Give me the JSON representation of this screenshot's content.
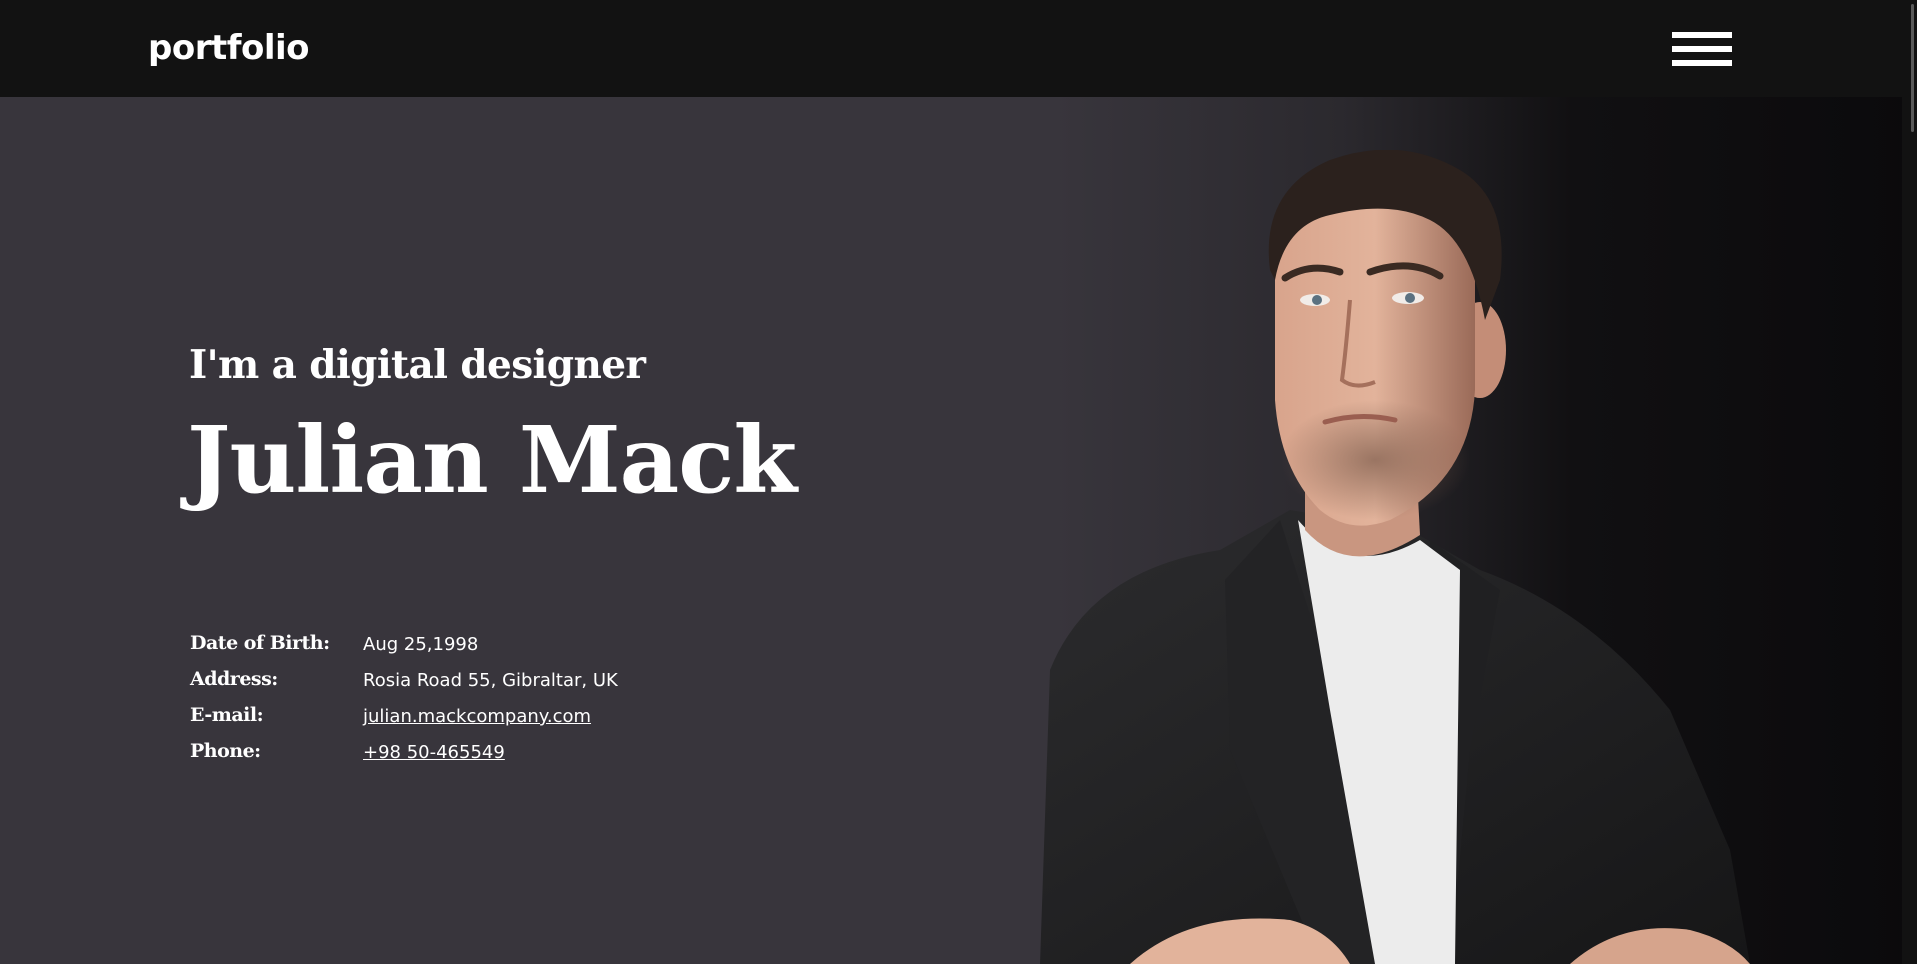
{
  "header": {
    "brand": "portfolio",
    "menu_icon": "hamburger-menu-icon"
  },
  "hero": {
    "subtitle": "I'm a digital designer",
    "name": "Julian Mack",
    "portrait_icon": "profile-photo"
  },
  "info": [
    {
      "label": "Date of Birth:",
      "value": "Aug 25,1998"
    },
    {
      "label": "Address:",
      "value": "Rosia Road 55, Gibraltar, UK"
    },
    {
      "label": "E-mail:",
      "value": "julian.mackcompany.com"
    },
    {
      "label": "Phone:",
      "value": "+98 50-465549"
    }
  ],
  "colors": {
    "header_bg": "#121212",
    "hero_bg": "#38353c",
    "text": "#ffffff"
  }
}
